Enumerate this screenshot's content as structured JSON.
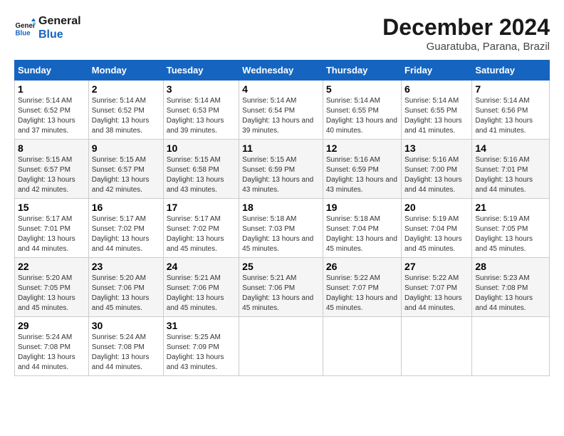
{
  "logo": {
    "line1": "General",
    "line2": "Blue"
  },
  "title": "December 2024",
  "subtitle": "Guaratuba, Parana, Brazil",
  "days_of_week": [
    "Sunday",
    "Monday",
    "Tuesday",
    "Wednesday",
    "Thursday",
    "Friday",
    "Saturday"
  ],
  "weeks": [
    [
      {
        "day": "1",
        "sunrise": "5:14 AM",
        "sunset": "6:52 PM",
        "daylight": "13 hours and 37 minutes."
      },
      {
        "day": "2",
        "sunrise": "5:14 AM",
        "sunset": "6:52 PM",
        "daylight": "13 hours and 38 minutes."
      },
      {
        "day": "3",
        "sunrise": "5:14 AM",
        "sunset": "6:53 PM",
        "daylight": "13 hours and 39 minutes."
      },
      {
        "day": "4",
        "sunrise": "5:14 AM",
        "sunset": "6:54 PM",
        "daylight": "13 hours and 39 minutes."
      },
      {
        "day": "5",
        "sunrise": "5:14 AM",
        "sunset": "6:55 PM",
        "daylight": "13 hours and 40 minutes."
      },
      {
        "day": "6",
        "sunrise": "5:14 AM",
        "sunset": "6:55 PM",
        "daylight": "13 hours and 41 minutes."
      },
      {
        "day": "7",
        "sunrise": "5:14 AM",
        "sunset": "6:56 PM",
        "daylight": "13 hours and 41 minutes."
      }
    ],
    [
      {
        "day": "8",
        "sunrise": "5:15 AM",
        "sunset": "6:57 PM",
        "daylight": "13 hours and 42 minutes."
      },
      {
        "day": "9",
        "sunrise": "5:15 AM",
        "sunset": "6:57 PM",
        "daylight": "13 hours and 42 minutes."
      },
      {
        "day": "10",
        "sunrise": "5:15 AM",
        "sunset": "6:58 PM",
        "daylight": "13 hours and 43 minutes."
      },
      {
        "day": "11",
        "sunrise": "5:15 AM",
        "sunset": "6:59 PM",
        "daylight": "13 hours and 43 minutes."
      },
      {
        "day": "12",
        "sunrise": "5:16 AM",
        "sunset": "6:59 PM",
        "daylight": "13 hours and 43 minutes."
      },
      {
        "day": "13",
        "sunrise": "5:16 AM",
        "sunset": "7:00 PM",
        "daylight": "13 hours and 44 minutes."
      },
      {
        "day": "14",
        "sunrise": "5:16 AM",
        "sunset": "7:01 PM",
        "daylight": "13 hours and 44 minutes."
      }
    ],
    [
      {
        "day": "15",
        "sunrise": "5:17 AM",
        "sunset": "7:01 PM",
        "daylight": "13 hours and 44 minutes."
      },
      {
        "day": "16",
        "sunrise": "5:17 AM",
        "sunset": "7:02 PM",
        "daylight": "13 hours and 44 minutes."
      },
      {
        "day": "17",
        "sunrise": "5:17 AM",
        "sunset": "7:02 PM",
        "daylight": "13 hours and 45 minutes."
      },
      {
        "day": "18",
        "sunrise": "5:18 AM",
        "sunset": "7:03 PM",
        "daylight": "13 hours and 45 minutes."
      },
      {
        "day": "19",
        "sunrise": "5:18 AM",
        "sunset": "7:04 PM",
        "daylight": "13 hours and 45 minutes."
      },
      {
        "day": "20",
        "sunrise": "5:19 AM",
        "sunset": "7:04 PM",
        "daylight": "13 hours and 45 minutes."
      },
      {
        "day": "21",
        "sunrise": "5:19 AM",
        "sunset": "7:05 PM",
        "daylight": "13 hours and 45 minutes."
      }
    ],
    [
      {
        "day": "22",
        "sunrise": "5:20 AM",
        "sunset": "7:05 PM",
        "daylight": "13 hours and 45 minutes."
      },
      {
        "day": "23",
        "sunrise": "5:20 AM",
        "sunset": "7:06 PM",
        "daylight": "13 hours and 45 minutes."
      },
      {
        "day": "24",
        "sunrise": "5:21 AM",
        "sunset": "7:06 PM",
        "daylight": "13 hours and 45 minutes."
      },
      {
        "day": "25",
        "sunrise": "5:21 AM",
        "sunset": "7:06 PM",
        "daylight": "13 hours and 45 minutes."
      },
      {
        "day": "26",
        "sunrise": "5:22 AM",
        "sunset": "7:07 PM",
        "daylight": "13 hours and 45 minutes."
      },
      {
        "day": "27",
        "sunrise": "5:22 AM",
        "sunset": "7:07 PM",
        "daylight": "13 hours and 44 minutes."
      },
      {
        "day": "28",
        "sunrise": "5:23 AM",
        "sunset": "7:08 PM",
        "daylight": "13 hours and 44 minutes."
      }
    ],
    [
      {
        "day": "29",
        "sunrise": "5:24 AM",
        "sunset": "7:08 PM",
        "daylight": "13 hours and 44 minutes."
      },
      {
        "day": "30",
        "sunrise": "5:24 AM",
        "sunset": "7:08 PM",
        "daylight": "13 hours and 44 minutes."
      },
      {
        "day": "31",
        "sunrise": "5:25 AM",
        "sunset": "7:09 PM",
        "daylight": "13 hours and 43 minutes."
      },
      null,
      null,
      null,
      null
    ]
  ]
}
